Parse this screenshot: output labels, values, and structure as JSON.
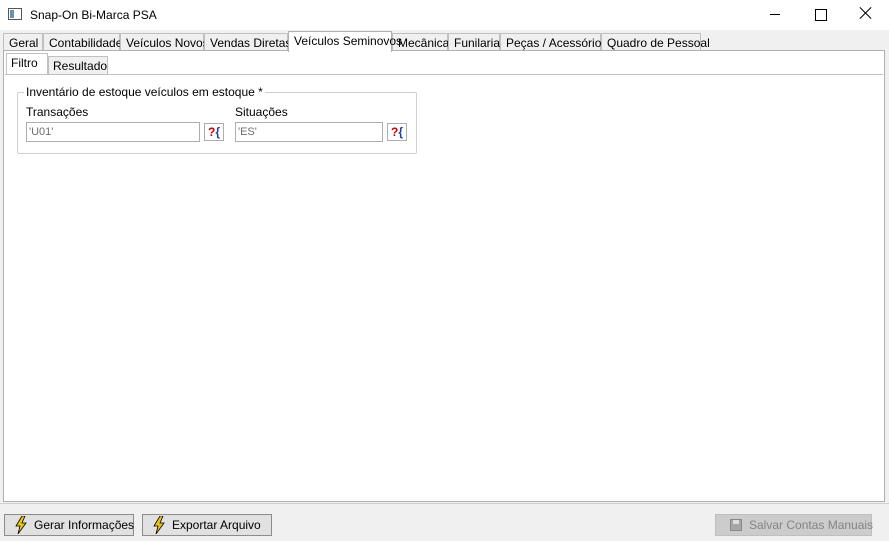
{
  "window": {
    "title": "Snap-On Bi-Marca PSA"
  },
  "main_tabs": [
    {
      "label": "Geral"
    },
    {
      "label": "Contabilidade"
    },
    {
      "label": "Veículos Novos"
    },
    {
      "label": "Vendas Diretas"
    },
    {
      "label": "Veículos Seminovos"
    },
    {
      "label": "Mecânica"
    },
    {
      "label": "Funilaria"
    },
    {
      "label": "Peças / Acessórios"
    },
    {
      "label": "Quadro de Pessoal"
    }
  ],
  "active_main_tab": "Veículos Seminovos",
  "sub_tabs": [
    {
      "label": "Filtro"
    },
    {
      "label": "Resultado"
    }
  ],
  "filter": {
    "group_title": "Inventário de estoque veículos em estoque *",
    "transacoes": {
      "label": "Transações",
      "value": "'U01'"
    },
    "situacoes": {
      "label": "Situações",
      "value": "'ES'"
    }
  },
  "buttons": {
    "gerar": {
      "label": "Gerar Informações"
    },
    "exportar": {
      "label": "Exportar Arquivo"
    },
    "salvar": {
      "label": "Salvar Contas Manuais"
    }
  },
  "icons": {
    "app": "app-window-icon",
    "action": "lightning-bolt-icon",
    "save": "floppy-disk-icon",
    "picker": "question-lookup-icon"
  },
  "colors": {
    "accent_bolt": "#e8c619",
    "picker_question": "#cc0000",
    "picker_brace": "#1f3f9f"
  }
}
